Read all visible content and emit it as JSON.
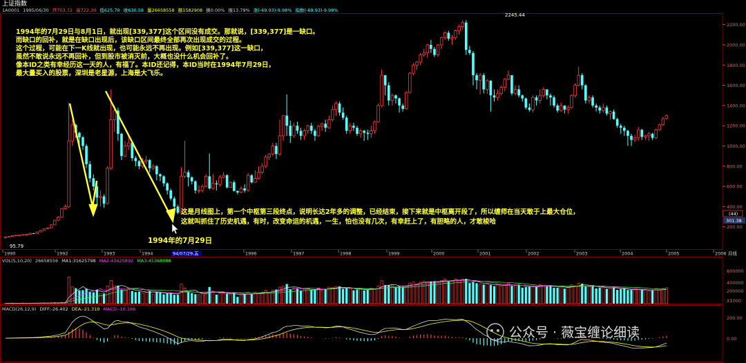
{
  "title": "上证指数",
  "info_bar": {
    "code": "1A0001",
    "date": "1995/06/30",
    "open": "开703.72",
    "high": "高722.30",
    "low": "低625.70",
    "close": "收630.58",
    "volume": "量26658558",
    "amount": "额1582908",
    "turnover": "换0.00%",
    "amplitude": "振13.79%",
    "change": "涨(-69.93)-9.98%",
    "index_change": "指数(-69.93)-9.98%"
  },
  "annotations": {
    "top_lines": [
      "1994年的7月29日与8月1日，就出现[339,377]这个区间没有成交。那就说，[339,377]是一缺口。",
      "而缺口的回补，就是在缺口出现后，该缺口区间最终全部再次出现成交的过程。",
      "这个过程，可能在下一K线就出现，也可能永远不再出现。例如[339,377]这一缺口，",
      "虽然不敢说永远不再回补，但到股市被消灭前，大概也没什么机会回补了。",
      "像本ID之类有幸经历这一天的人，有福了。本ID还记得，本ID当时在1994年7月29日，",
      "最大量买入的股票，深圳是老星源，上海是大飞乐。"
    ],
    "middle_lines": [
      "这是月线图上，第一个中枢第三段终点，说明长达2年多的调整，已经结束，接下来就是中枢离开段了，所以缠师在当天敢于上最大仓位，",
      "这就叫抓住了历史机遇，有时，改变命运的机遇，一生，怕也没有几次，有幸赶上了，有胆略的人，才敢梭哈"
    ],
    "date_label": "1994年的7月29日",
    "high_label": "2245.44",
    "low_label": "95.79"
  },
  "cursor_date": "94/07/29,五",
  "price_panel": {
    "axis_labels": [
      "2200.00",
      "2000.00",
      "1800.00",
      "1600.00",
      "1400.00",
      "1200.00",
      "1000.00",
      "800.00",
      "600.00",
      "400.00",
      "200.00"
    ],
    "axis_values": [
      2200,
      2000,
      1800,
      1600,
      1400,
      1200,
      1000,
      800,
      600,
      400,
      200
    ],
    "cursor_box": "(44)",
    "cursor_value": "301.38",
    "period_label": "月线"
  },
  "x_axis": {
    "years": [
      "1990",
      "1992",
      "1993",
      "1994",
      "95",
      "1996",
      "1997",
      "1998",
      "1999",
      "2000",
      "2001",
      "2002",
      "2003",
      "2004",
      "2005",
      "2006"
    ]
  },
  "volume_panel": {
    "header": "VOL(5,10,20)",
    "vol_value": "26658556",
    "ma1": "MA1:31625798",
    "ma2": "MA2:43420892",
    "ma3": "MA3:45368088",
    "axis_labels": [
      "600000",
      "400000",
      "200000",
      "X1000"
    ]
  },
  "macd_panel": {
    "header": "MACD(26,12,9)",
    "diff": "DIFF:-26.402",
    "dea": "DEA:-21.319",
    "macd": "MACD:-10.166",
    "axis_labels": [
      "200.00",
      "0.00"
    ]
  },
  "watermark": "公众号 · 薇宝缠论细读",
  "colors": {
    "up": "#ff3b3b",
    "down": "#54ffff",
    "annotation_yellow": "#ffff3c",
    "grid": "#7a0000",
    "axis_text": "#ff5a5a",
    "ma1": "#e0e0e0",
    "ma2": "#ff40ff",
    "ma3": "#40ff40",
    "diff": "#e0e0e0",
    "dea": "#ffff00"
  },
  "chart_data": {
    "type": "candlestick",
    "title": "上证指数",
    "period": "月线",
    "ylim": [
      0,
      2300
    ],
    "key_points": [
      {
        "label": "95.79",
        "value": 95.79,
        "period": "1990-12"
      },
      {
        "label": "2245.44",
        "value": 2245.44,
        "period": "2001-06"
      },
      {
        "label": "1994年的7月29日",
        "value": 325.89,
        "period": "1994-07"
      }
    ],
    "candles": [
      [
        100,
        100,
        100,
        97
      ],
      [
        100,
        105,
        106,
        99
      ],
      [
        105,
        112,
        114,
        104
      ],
      [
        112,
        117,
        118,
        110
      ],
      [
        117,
        118,
        121,
        115
      ],
      [
        118,
        124,
        125,
        117
      ],
      [
        124,
        126,
        129,
        123
      ],
      [
        126,
        136,
        138,
        125
      ],
      [
        136,
        135,
        140,
        132
      ],
      [
        135,
        150,
        152,
        133
      ],
      [
        150,
        165,
        168,
        148
      ],
      [
        165,
        182,
        185,
        163
      ],
      [
        182,
        190,
        196,
        178
      ],
      [
        190,
        220,
        225,
        188
      ],
      [
        220,
        265,
        270,
        218
      ],
      [
        265,
        295,
        305,
        260
      ],
      [
        295,
        380,
        385,
        292
      ],
      [
        380,
        398,
        420,
        370
      ],
      [
        398,
        1050,
        1429,
        390
      ],
      [
        1050,
        1208,
        1260,
        1000
      ],
      [
        1208,
        1130,
        1220,
        1080
      ],
      [
        1130,
        1085,
        1140,
        1000
      ],
      [
        1085,
        1000,
        1100,
        960
      ],
      [
        1000,
        820,
        1020,
        780
      ],
      [
        820,
        680,
        850,
        640
      ],
      [
        680,
        600,
        720,
        560
      ],
      [
        600,
        490,
        640,
        420
      ],
      [
        490,
        500,
        560,
        400
      ],
      [
        500,
        430,
        520,
        390
      ],
      [
        430,
        780,
        800,
        420
      ],
      [
        780,
        1260,
        1558,
        760
      ],
      [
        1260,
        1350,
        1400,
        1140
      ],
      [
        1350,
        1120,
        1380,
        1050
      ],
      [
        1120,
        900,
        1130,
        860
      ],
      [
        900,
        1000,
        1050,
        890
      ],
      [
        1000,
        1030,
        1100,
        960
      ],
      [
        1030,
        880,
        1050,
        850
      ],
      [
        880,
        850,
        900,
        800
      ],
      [
        850,
        800,
        860,
        770
      ],
      [
        800,
        850,
        880,
        780
      ],
      [
        850,
        860,
        900,
        820
      ],
      [
        860,
        780,
        870,
        740
      ],
      [
        780,
        800,
        820,
        760
      ],
      [
        800,
        720,
        810,
        660
      ],
      [
        720,
        700,
        730,
        650
      ],
      [
        700,
        630,
        710,
        600
      ],
      [
        630,
        560,
        640,
        520
      ],
      [
        560,
        480,
        580,
        460
      ],
      [
        480,
        400,
        500,
        380
      ],
      [
        400,
        340,
        420,
        325
      ],
      [
        340,
        700,
        790,
        326
      ],
      [
        700,
        740,
        1052,
        680
      ],
      [
        740,
        690,
        760,
        600
      ],
      [
        690,
        650,
        700,
        620
      ],
      [
        650,
        560,
        660,
        530
      ],
      [
        560,
        560,
        610,
        530
      ],
      [
        560,
        600,
        620,
        540
      ],
      [
        600,
        700,
        720,
        590
      ],
      [
        700,
        580,
        926,
        570
      ],
      [
        580,
        630,
        722,
        570
      ],
      [
        630,
        620,
        660,
        560
      ],
      [
        620,
        690,
        710,
        600
      ],
      [
        690,
        710,
        740,
        680
      ],
      [
        710,
        590,
        720,
        580
      ],
      [
        590,
        640,
        650,
        590
      ],
      [
        640,
        555,
        660,
        550
      ],
      [
        555,
        540,
        560,
        520
      ],
      [
        540,
        580,
        600,
        530
      ],
      [
        580,
        560,
        620,
        540
      ],
      [
        560,
        710,
        730,
        550
      ],
      [
        710,
        640,
        720,
        630
      ],
      [
        640,
        680,
        760,
        640
      ],
      [
        680,
        740,
        800,
        670
      ],
      [
        740,
        800,
        830,
        720
      ],
      [
        800,
        890,
        910,
        780
      ],
      [
        890,
        920,
        930,
        860
      ],
      [
        920,
        1000,
        1030,
        900
      ],
      [
        1000,
        920,
        1030,
        870
      ],
      [
        920,
        1100,
        1260,
        900
      ],
      [
        1100,
        1300,
        1300,
        1050
      ],
      [
        1300,
        1200,
        1510,
        1100
      ],
      [
        1200,
        1100,
        1250,
        1030
      ],
      [
        1100,
        1200,
        1230,
        1080
      ],
      [
        1200,
        1150,
        1240,
        1120
      ],
      [
        1150,
        1100,
        1180,
        1060
      ],
      [
        1100,
        1150,
        1170,
        1060
      ],
      [
        1150,
        1200,
        1210,
        1120
      ],
      [
        1200,
        1150,
        1230,
        1120
      ],
      [
        1150,
        1100,
        1170,
        1050
      ],
      [
        1100,
        1194,
        1210,
        1090
      ],
      [
        1194,
        1220,
        1230,
        1150
      ],
      [
        1220,
        1180,
        1260,
        1140
      ],
      [
        1180,
        1260,
        1300,
        1170
      ],
      [
        1260,
        1360,
        1400,
        1240
      ],
      [
        1360,
        1420,
        1440,
        1300
      ],
      [
        1420,
        1330,
        1440,
        1300
      ],
      [
        1330,
        1280,
        1380,
        1260
      ],
      [
        1280,
        1150,
        1300,
        1120
      ],
      [
        1150,
        1200,
        1230,
        1120
      ],
      [
        1200,
        1180,
        1230,
        1150
      ],
      [
        1180,
        1120,
        1200,
        1100
      ],
      [
        1120,
        1150,
        1170,
        1080
      ],
      [
        1150,
        1130,
        1160,
        1050
      ],
      [
        1130,
        1120,
        1160,
        1060
      ],
      [
        1120,
        1150,
        1200,
        1080
      ],
      [
        1150,
        1240,
        1250,
        1120
      ],
      [
        1240,
        1400,
        1420,
        1230
      ],
      [
        1400,
        1700,
        1756,
        1380
      ],
      [
        1700,
        1600,
        1700,
        1500
      ],
      [
        1600,
        1450,
        1630,
        1400
      ],
      [
        1450,
        1500,
        1520,
        1400
      ],
      [
        1500,
        1470,
        1510,
        1420
      ],
      [
        1470,
        1400,
        1480,
        1330
      ],
      [
        1400,
        1367,
        1420,
        1340
      ],
      [
        1367,
        1530,
        1540,
        1360
      ],
      [
        1530,
        1720,
        1730,
        1520
      ],
      [
        1720,
        1800,
        1820,
        1700
      ],
      [
        1800,
        1830,
        1840,
        1750
      ],
      [
        1830,
        1900,
        1920,
        1800
      ],
      [
        1900,
        1920,
        1960,
        1880
      ],
      [
        1920,
        2000,
        2010,
        1870
      ],
      [
        2000,
        1960,
        2050,
        1920
      ],
      [
        1960,
        1900,
        1980,
        1880
      ],
      [
        1900,
        2000,
        2010,
        1880
      ],
      [
        2000,
        2070,
        2080,
        1960
      ],
      [
        2070,
        2120,
        2130,
        2050
      ],
      [
        2120,
        2060,
        2140,
        2040
      ],
      [
        2060,
        2070,
        2100,
        2000
      ],
      [
        2070,
        2140,
        2150,
        2050
      ],
      [
        2140,
        2180,
        2200,
        2100
      ],
      [
        2180,
        2220,
        2245,
        2150
      ],
      [
        2220,
        1950,
        2245,
        1900
      ],
      [
        1950,
        1920,
        1990,
        1900
      ],
      [
        1920,
        1700,
        1940,
        1600
      ],
      [
        1700,
        1650,
        1720,
        1560
      ],
      [
        1650,
        1700,
        1720,
        1510
      ],
      [
        1700,
        1560,
        1720,
        1520
      ],
      [
        1560,
        1645,
        1660,
        1514
      ],
      [
        1645,
        1500,
        1650,
        1340
      ],
      [
        1500,
        1480,
        1560,
        1440
      ],
      [
        1480,
        1520,
        1560,
        1450
      ],
      [
        1520,
        1580,
        1600,
        1500
      ],
      [
        1580,
        1660,
        1670,
        1540
      ],
      [
        1660,
        1700,
        1748,
        1650
      ],
      [
        1700,
        1520,
        1700,
        1500
      ],
      [
        1520,
        1560,
        1600,
        1500
      ],
      [
        1560,
        1500,
        1600,
        1480
      ],
      [
        1500,
        1470,
        1510,
        1440
      ],
      [
        1470,
        1380,
        1480,
        1360
      ],
      [
        1380,
        1357,
        1420,
        1340
      ],
      [
        1357,
        1480,
        1500,
        1330
      ],
      [
        1480,
        1450,
        1500,
        1400
      ],
      [
        1450,
        1500,
        1560,
        1420
      ],
      [
        1500,
        1560,
        1580,
        1480
      ],
      [
        1560,
        1500,
        1560,
        1460
      ],
      [
        1500,
        1480,
        1520,
        1400
      ],
      [
        1480,
        1400,
        1500,
        1380
      ],
      [
        1400,
        1350,
        1420,
        1330
      ],
      [
        1350,
        1400,
        1430,
        1340
      ],
      [
        1400,
        1360,
        1400,
        1320
      ],
      [
        1360,
        1380,
        1400,
        1320
      ],
      [
        1380,
        1497,
        1510,
        1370
      ],
      [
        1497,
        1600,
        1620,
        1480
      ],
      [
        1600,
        1700,
        1783,
        1590
      ],
      [
        1700,
        1600,
        1720,
        1560
      ],
      [
        1600,
        1450,
        1610,
        1420
      ],
      [
        1450,
        1480,
        1500,
        1420
      ],
      [
        1480,
        1400,
        1500,
        1380
      ],
      [
        1400,
        1380,
        1420,
        1340
      ],
      [
        1380,
        1350,
        1400,
        1320
      ],
      [
        1350,
        1380,
        1420,
        1330
      ],
      [
        1380,
        1320,
        1400,
        1300
      ],
      [
        1320,
        1340,
        1350,
        1260
      ],
      [
        1340,
        1266,
        1360,
        1260
      ],
      [
        1266,
        1200,
        1280,
        1180
      ],
      [
        1200,
        1180,
        1220,
        1120
      ],
      [
        1180,
        1150,
        1200,
        1100
      ],
      [
        1150,
        1100,
        1160,
        1000
      ],
      [
        1100,
        1060,
        1120,
        1000
      ],
      [
        1060,
        1080,
        1110,
        1040
      ],
      [
        1080,
        1160,
        1190,
        1050
      ],
      [
        1160,
        1090,
        1170,
        1060
      ],
      [
        1090,
        1100,
        1110,
        1060
      ],
      [
        1100,
        1120,
        1140,
        1050
      ],
      [
        1120,
        1080,
        1130,
        1060
      ],
      [
        1080,
        1161,
        1170,
        1070
      ],
      [
        1161,
        1210,
        1220,
        1150
      ],
      [
        1210,
        1270,
        1290,
        1200
      ],
      [
        1270,
        1300,
        1310,
        1260
      ]
    ]
  }
}
